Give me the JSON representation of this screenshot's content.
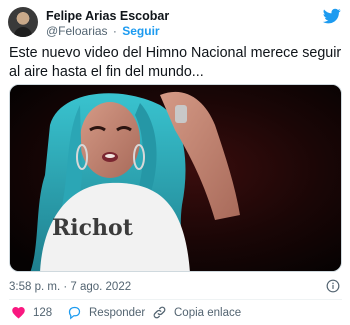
{
  "author": {
    "name": "Felipe Arias Escobar",
    "handle": "@Feloarias",
    "separator": "·",
    "follow_label": "Seguir"
  },
  "tweet": {
    "text": "Este nuevo video del Himno Nacional merece seguir al aire hasta el fin del mundo..."
  },
  "media": {
    "shirt_text": "Richot"
  },
  "meta": {
    "timestamp": "3:58 p. m. · 7 ago. 2022"
  },
  "actions": {
    "like_count": "128",
    "reply_label": "Responder",
    "copy_label": "Copia enlace"
  },
  "colors": {
    "brand_blue": "#1d9bf0",
    "like_red": "#f91880",
    "text_secondary": "#536471",
    "hair_teal": "#2ba6b5"
  },
  "icons": [
    "twitter-bird-icon",
    "info-icon",
    "heart-icon",
    "reply-icon",
    "link-icon"
  ]
}
